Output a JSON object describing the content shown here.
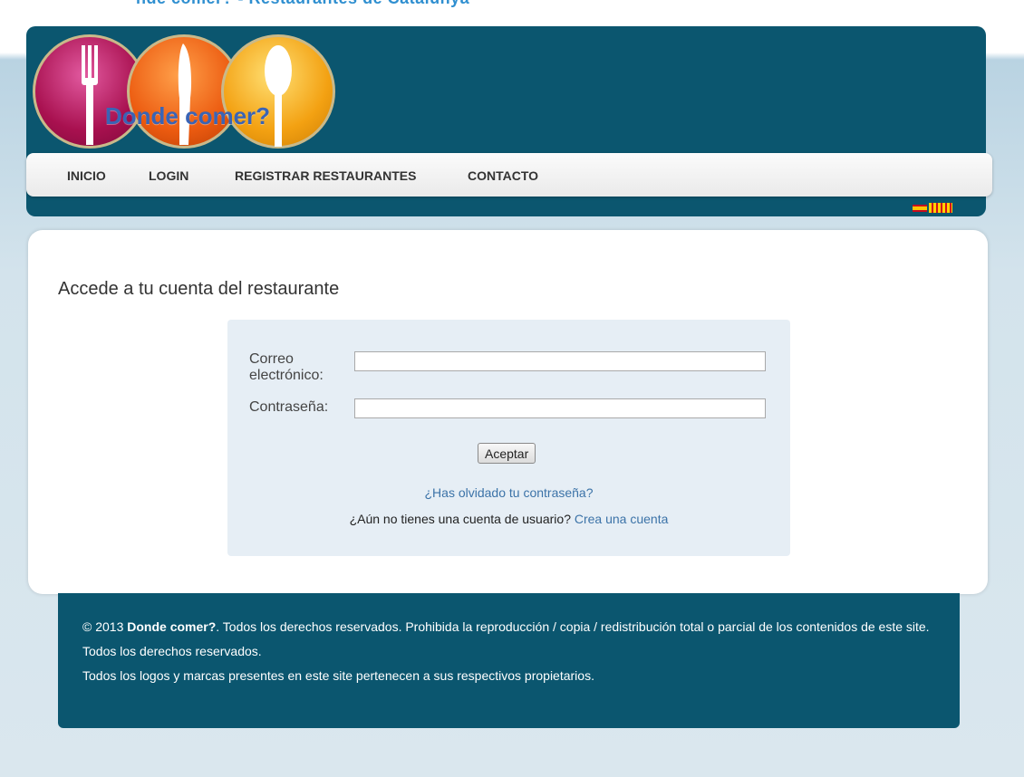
{
  "site": {
    "brand_name": "Donde comer?"
  },
  "top_strip_text": "nde comer? - Restaurantes de Catalunya",
  "nav": {
    "items": [
      "INICIO",
      "LOGIN",
      "REGISTRAR RESTAURANTES",
      "CONTACTO"
    ]
  },
  "language_flags": [
    "es-flag-icon",
    "catalonia-flag-icon"
  ],
  "login": {
    "title": "Accede a tu cuenta del restaurante",
    "email_label": "Correo electrónico:",
    "password_label": "Contraseña:",
    "email_value": "",
    "password_value": "",
    "submit_label": "Aceptar",
    "forgot_link": "¿Has olvidado tu contraseña?",
    "no_account_text": "¿Aún no tienes una cuenta de usuario?",
    "create_account_link": "Crea una cuenta"
  },
  "footer": {
    "copyright_prefix": "© 2013",
    "brand": "Donde comer?",
    "line1_rest": ". Todos los derechos reservados. Prohibida la reproducción / copia / redistribución total o parcial de los contenidos de este site. Todos los derechos reservados.",
    "line2": "Todos los logos y marcas presentes en este site pertenecen a sus respectivos propietarios."
  },
  "colors": {
    "header_bg": "#0b566f",
    "footer_bg": "#0b566f",
    "link": "#3c73a8",
    "page_bg": "#dae7ee"
  }
}
